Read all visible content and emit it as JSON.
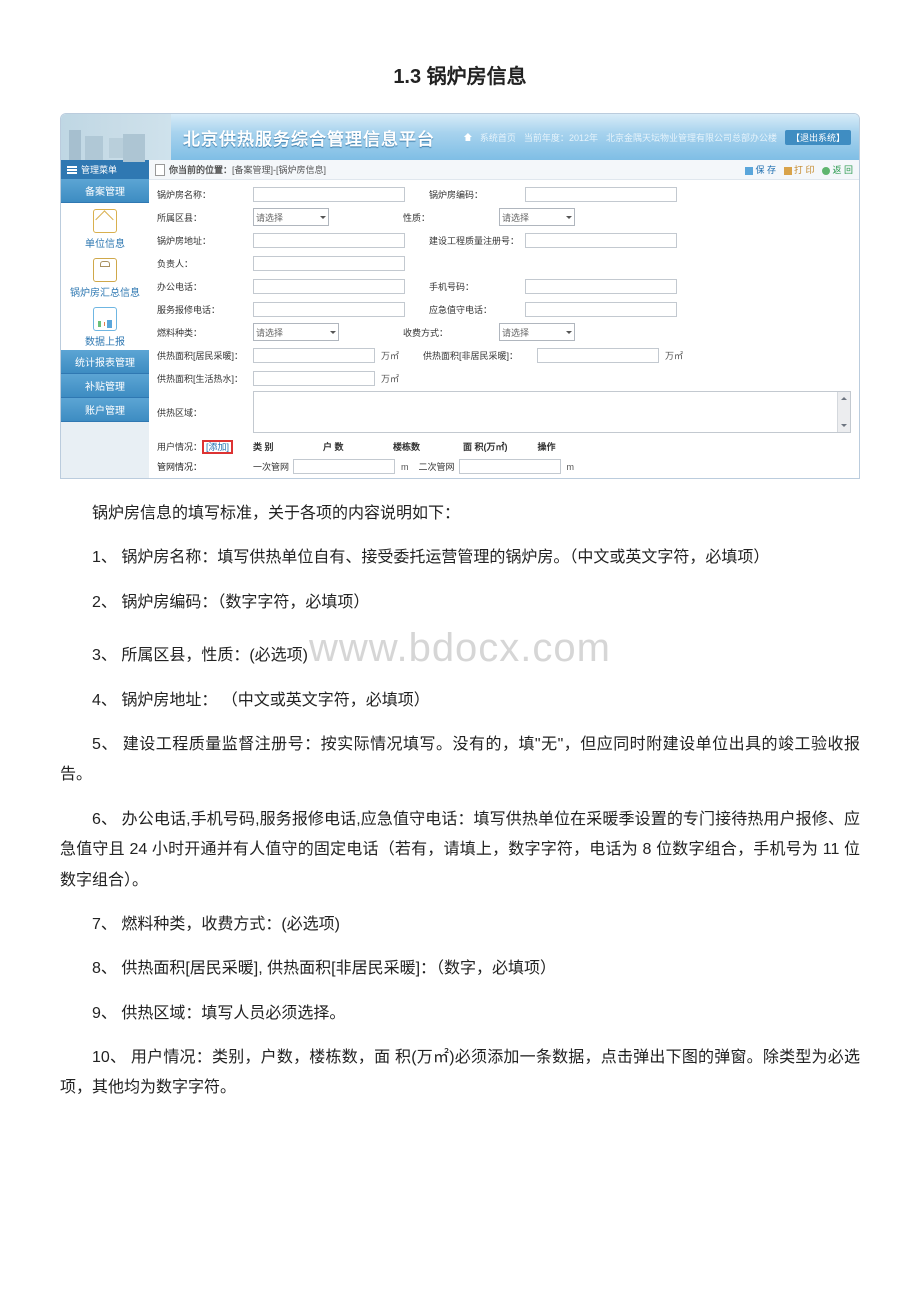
{
  "doc": {
    "title": "1.3 锅炉房信息",
    "intro": "锅炉房信息的填写标准，关于各项的内容说明如下：",
    "items": [
      "1、 锅炉房名称：填写供热单位自有、接受委托运营管理的锅炉房。（中文或英文字符，必填项）",
      "2、 锅炉房编码：（数字字符，必填项）",
      "3、 所属区县，性质：(必选项)",
      "4、 锅炉房地址： （中文或英文字符，必填项）",
      "5、 建设工程质量监督注册号：按实际情况填写。没有的，填\"无\"，但应同时附建设单位出具的竣工验收报告。",
      "6、 办公电话,手机号码,服务报修电话,应急值守电话：填写供热单位在采暖季设置的专门接待热用户报修、应急值守且 24 小时开通并有人值守的固定电话（若有，请填上，数字字符，电话为 8 位数字组合，手机号为 11 位数字组合）。",
      "7、 燃料种类，收费方式：(必选项)",
      "8、 供热面积[居民采暖], 供热面积[非居民采暖]：（数字，必填项）",
      "9、 供热区域：填写人员必须选择。",
      "10、 用户情况：类别，户数，楼栋数，面 积(万㎡)必须添加一条数据，点击弹出下图的弹窗。除类型为必选项，其他均为数字字符。"
    ],
    "watermark": "www.bdocx.com"
  },
  "app": {
    "title": "北京供热服务综合管理信息平台",
    "header_links": {
      "home": "系统首页",
      "year_label": "当前年度：",
      "year": "2012年",
      "company": "北京金隅天坛物业管理有限公司总部办公楼",
      "logout": "【退出系统】"
    },
    "sidebar_top": "管理菜单",
    "sidebar": [
      "备案管理",
      "单位信息",
      "锅炉房汇总信息",
      "数据上报",
      "统计报表管理",
      "补贴管理",
      "账户管理"
    ],
    "breadcrumb": {
      "label": "你当前的位置：",
      "path": "[备案管理]-[锅炉房信息]"
    },
    "toolbar": {
      "save": "保 存",
      "print": "打 印",
      "back": "返 回"
    },
    "form": {
      "boiler_name": "锅炉房名称：",
      "boiler_code": "锅炉房编码：",
      "district": "所属区县：",
      "nature": "性质：",
      "addr": "锅炉房地址：",
      "cons_no": "建设工程质量注册号：",
      "person": "负责人：",
      "office_tel": "办公电话：",
      "mobile": "手机号码：",
      "repair_tel": "服务报修电话：",
      "duty_tel": "应急值守电话：",
      "fuel": "燃料种类：",
      "charge": "收费方式：",
      "area_res": "供热面积[居民采暖]：",
      "area_nonres": "供热面积[非居民采暖]：",
      "area_hot": "供热面积[生活热水]：",
      "area_unit": "万㎡",
      "zone": "供热区域：",
      "user_label": "用户情况：",
      "user_add": "[添加]",
      "user_headers": [
        "类 别",
        "户 数",
        "楼栋数",
        "面 积(万㎡)",
        "操作"
      ],
      "pipe_label": "管网情况：",
      "pipe1": "一次管网",
      "pipe2": "二次管网",
      "pipe_unit": "m",
      "select_ph": "请选择"
    }
  }
}
